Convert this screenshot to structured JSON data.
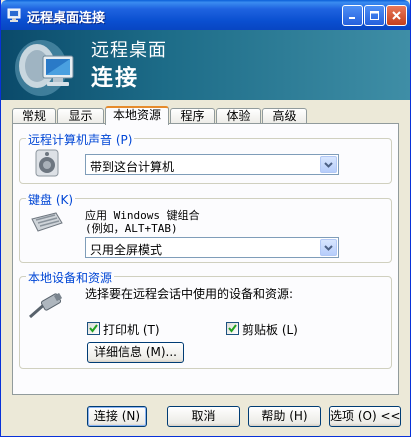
{
  "window": {
    "title": "远程桌面连接"
  },
  "banner": {
    "line1": "远程桌面",
    "line2": "连接"
  },
  "tabs": [
    {
      "label": "常规"
    },
    {
      "label": "显示"
    },
    {
      "label": "本地资源",
      "active": true
    },
    {
      "label": "程序"
    },
    {
      "label": "体验"
    },
    {
      "label": "高级"
    }
  ],
  "sound": {
    "legend": "远程计算机声音 (P)",
    "selected": "带到这台计算机"
  },
  "keyboard": {
    "legend": "键盘 (K)",
    "desc_line1": "应用 Windows 键组合",
    "desc_line2": "(例如，ALT+TAB)",
    "selected": "只用全屏模式"
  },
  "devices": {
    "legend": "本地设备和资源",
    "desc": "选择要在远程会话中使用的设备和资源:",
    "printers": {
      "label": "打印机 (T)",
      "checked": true
    },
    "clipboard": {
      "label": "剪贴板 (L)",
      "checked": true
    },
    "more_button": "详细信息 (M)..."
  },
  "footer": {
    "connect": "连接 (N)",
    "cancel": "取消",
    "help": "帮助 (H)",
    "options": "选项 (O) <<"
  },
  "colors": {
    "titlebar": "#0a4fd0",
    "legend_text": "#0046d5",
    "checkmark": "#21a121",
    "active_tab_accent": "#e68b2c"
  }
}
